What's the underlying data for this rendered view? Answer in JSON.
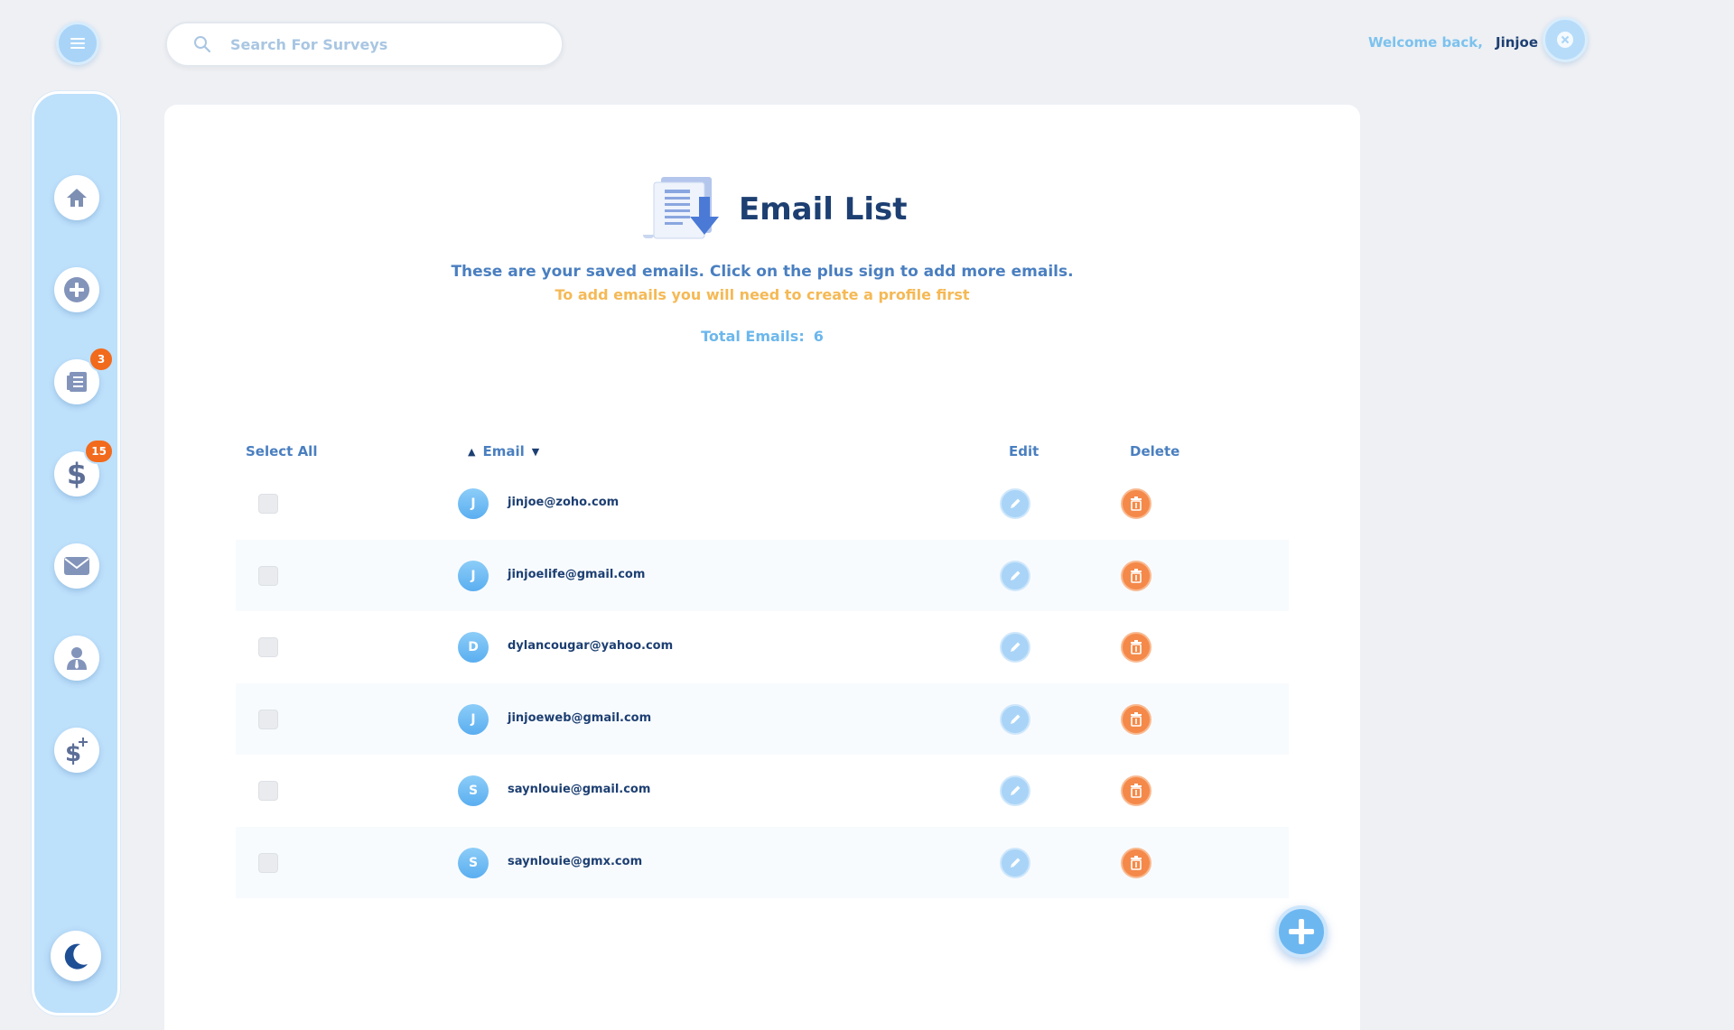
{
  "header": {
    "search_placeholder": "Search For Surveys",
    "welcome_text": "Welcome back,",
    "user_name": "Jinjoe"
  },
  "sidebar": {
    "items": [
      {
        "name": "home",
        "icon": "home-icon"
      },
      {
        "name": "create",
        "icon": "plus-circle-icon"
      },
      {
        "name": "surveys",
        "icon": "document-list-icon",
        "badge": "3"
      },
      {
        "name": "earnings",
        "icon": "dollar-icon",
        "badge": "15"
      },
      {
        "name": "email",
        "icon": "envelope-icon"
      },
      {
        "name": "profile",
        "icon": "user-icon"
      },
      {
        "name": "add-funds",
        "icon": "dollar-plus-icon"
      }
    ],
    "theme_toggle_icon": "moon-icon"
  },
  "main": {
    "title": "Email List",
    "subtitle": "These are your saved emails. Click on the plus sign to add more emails.",
    "note": "To add emails you will need to create a profile first",
    "total_label": "Total Emails:",
    "total_value": "6",
    "table": {
      "headers": {
        "select_all": "Select All",
        "email": "Email",
        "edit": "Edit",
        "delete": "Delete"
      },
      "rows": [
        {
          "initial": "J",
          "email": "jinjoe@zoho.com"
        },
        {
          "initial": "J",
          "email": "jinjoelife@gmail.com"
        },
        {
          "initial": "D",
          "email": "dylancougar@yahoo.com"
        },
        {
          "initial": "J",
          "email": "jinjoeweb@gmail.com"
        },
        {
          "initial": "S",
          "email": "saynlouie@gmail.com"
        },
        {
          "initial": "S",
          "email": "saynlouie@gmx.com"
        }
      ]
    }
  },
  "colors": {
    "sidebar_bg": "#bde0fb",
    "title": "#1d3f72",
    "accent_blue": "#6db7f1",
    "note_orange": "#f5b955",
    "badge_orange": "#f26a1b",
    "delete_orange": "#f4894a"
  }
}
